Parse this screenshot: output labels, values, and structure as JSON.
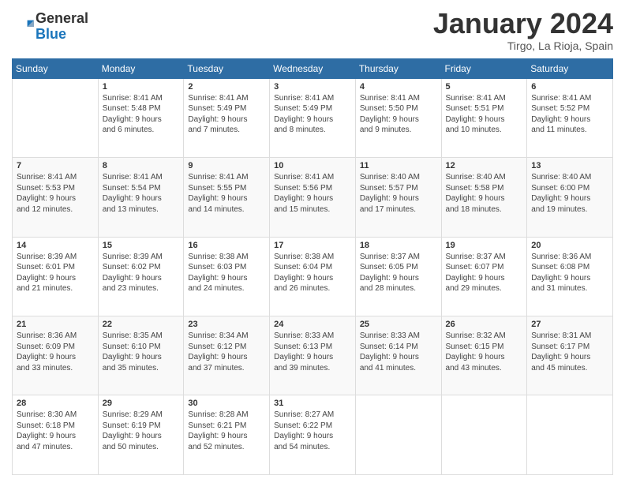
{
  "logo": {
    "general": "General",
    "blue": "Blue"
  },
  "title": "January 2024",
  "location": "Tirgo, La Rioja, Spain",
  "days_header": [
    "Sunday",
    "Monday",
    "Tuesday",
    "Wednesday",
    "Thursday",
    "Friday",
    "Saturday"
  ],
  "weeks": [
    [
      {
        "num": "",
        "info": ""
      },
      {
        "num": "1",
        "info": "Sunrise: 8:41 AM\nSunset: 5:48 PM\nDaylight: 9 hours\nand 6 minutes."
      },
      {
        "num": "2",
        "info": "Sunrise: 8:41 AM\nSunset: 5:49 PM\nDaylight: 9 hours\nand 7 minutes."
      },
      {
        "num": "3",
        "info": "Sunrise: 8:41 AM\nSunset: 5:49 PM\nDaylight: 9 hours\nand 8 minutes."
      },
      {
        "num": "4",
        "info": "Sunrise: 8:41 AM\nSunset: 5:50 PM\nDaylight: 9 hours\nand 9 minutes."
      },
      {
        "num": "5",
        "info": "Sunrise: 8:41 AM\nSunset: 5:51 PM\nDaylight: 9 hours\nand 10 minutes."
      },
      {
        "num": "6",
        "info": "Sunrise: 8:41 AM\nSunset: 5:52 PM\nDaylight: 9 hours\nand 11 minutes."
      }
    ],
    [
      {
        "num": "7",
        "info": "Sunrise: 8:41 AM\nSunset: 5:53 PM\nDaylight: 9 hours\nand 12 minutes."
      },
      {
        "num": "8",
        "info": "Sunrise: 8:41 AM\nSunset: 5:54 PM\nDaylight: 9 hours\nand 13 minutes."
      },
      {
        "num": "9",
        "info": "Sunrise: 8:41 AM\nSunset: 5:55 PM\nDaylight: 9 hours\nand 14 minutes."
      },
      {
        "num": "10",
        "info": "Sunrise: 8:41 AM\nSunset: 5:56 PM\nDaylight: 9 hours\nand 15 minutes."
      },
      {
        "num": "11",
        "info": "Sunrise: 8:40 AM\nSunset: 5:57 PM\nDaylight: 9 hours\nand 17 minutes."
      },
      {
        "num": "12",
        "info": "Sunrise: 8:40 AM\nSunset: 5:58 PM\nDaylight: 9 hours\nand 18 minutes."
      },
      {
        "num": "13",
        "info": "Sunrise: 8:40 AM\nSunset: 6:00 PM\nDaylight: 9 hours\nand 19 minutes."
      }
    ],
    [
      {
        "num": "14",
        "info": "Sunrise: 8:39 AM\nSunset: 6:01 PM\nDaylight: 9 hours\nand 21 minutes."
      },
      {
        "num": "15",
        "info": "Sunrise: 8:39 AM\nSunset: 6:02 PM\nDaylight: 9 hours\nand 23 minutes."
      },
      {
        "num": "16",
        "info": "Sunrise: 8:38 AM\nSunset: 6:03 PM\nDaylight: 9 hours\nand 24 minutes."
      },
      {
        "num": "17",
        "info": "Sunrise: 8:38 AM\nSunset: 6:04 PM\nDaylight: 9 hours\nand 26 minutes."
      },
      {
        "num": "18",
        "info": "Sunrise: 8:37 AM\nSunset: 6:05 PM\nDaylight: 9 hours\nand 28 minutes."
      },
      {
        "num": "19",
        "info": "Sunrise: 8:37 AM\nSunset: 6:07 PM\nDaylight: 9 hours\nand 29 minutes."
      },
      {
        "num": "20",
        "info": "Sunrise: 8:36 AM\nSunset: 6:08 PM\nDaylight: 9 hours\nand 31 minutes."
      }
    ],
    [
      {
        "num": "21",
        "info": "Sunrise: 8:36 AM\nSunset: 6:09 PM\nDaylight: 9 hours\nand 33 minutes."
      },
      {
        "num": "22",
        "info": "Sunrise: 8:35 AM\nSunset: 6:10 PM\nDaylight: 9 hours\nand 35 minutes."
      },
      {
        "num": "23",
        "info": "Sunrise: 8:34 AM\nSunset: 6:12 PM\nDaylight: 9 hours\nand 37 minutes."
      },
      {
        "num": "24",
        "info": "Sunrise: 8:33 AM\nSunset: 6:13 PM\nDaylight: 9 hours\nand 39 minutes."
      },
      {
        "num": "25",
        "info": "Sunrise: 8:33 AM\nSunset: 6:14 PM\nDaylight: 9 hours\nand 41 minutes."
      },
      {
        "num": "26",
        "info": "Sunrise: 8:32 AM\nSunset: 6:15 PM\nDaylight: 9 hours\nand 43 minutes."
      },
      {
        "num": "27",
        "info": "Sunrise: 8:31 AM\nSunset: 6:17 PM\nDaylight: 9 hours\nand 45 minutes."
      }
    ],
    [
      {
        "num": "28",
        "info": "Sunrise: 8:30 AM\nSunset: 6:18 PM\nDaylight: 9 hours\nand 47 minutes."
      },
      {
        "num": "29",
        "info": "Sunrise: 8:29 AM\nSunset: 6:19 PM\nDaylight: 9 hours\nand 50 minutes."
      },
      {
        "num": "30",
        "info": "Sunrise: 8:28 AM\nSunset: 6:21 PM\nDaylight: 9 hours\nand 52 minutes."
      },
      {
        "num": "31",
        "info": "Sunrise: 8:27 AM\nSunset: 6:22 PM\nDaylight: 9 hours\nand 54 minutes."
      },
      {
        "num": "",
        "info": ""
      },
      {
        "num": "",
        "info": ""
      },
      {
        "num": "",
        "info": ""
      }
    ]
  ]
}
